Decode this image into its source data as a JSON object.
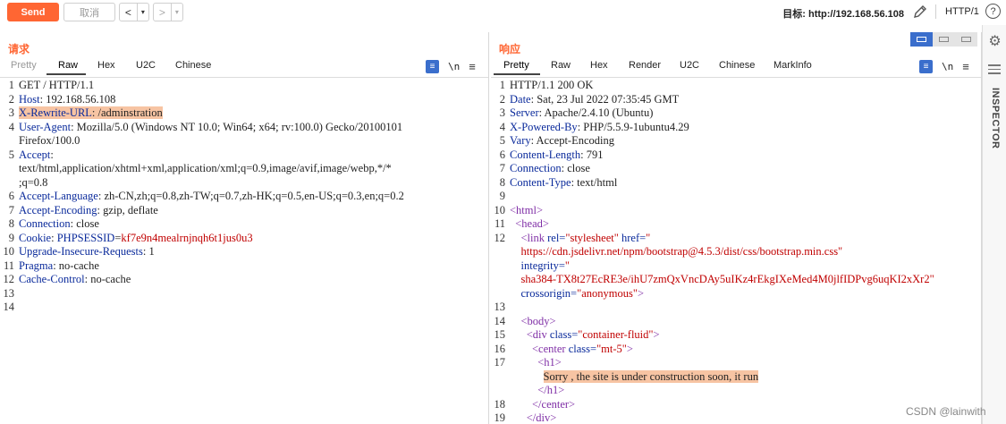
{
  "toolbar": {
    "send_label": "Send",
    "cancel_label": "取消",
    "back_arrow": "<",
    "forward_arrow": ">",
    "dropdown_glyph": "▾",
    "target_label": "目标: http://192.168.56.108",
    "http_version": "HTTP/1",
    "help_glyph": "?"
  },
  "request": {
    "title": "请求",
    "tabs": [
      "Pretty",
      "Raw",
      "Hex",
      "U2C",
      "Chinese"
    ],
    "active_tab": "Raw",
    "lines": [
      {
        "n": "1",
        "parts": [
          {
            "t": "GET / HTTP/1.1",
            "c": "v"
          }
        ]
      },
      {
        "n": "2",
        "parts": [
          {
            "t": "Host",
            "c": "k"
          },
          {
            "t": ": 192.168.56.108",
            "c": "v"
          }
        ]
      },
      {
        "n": "3",
        "parts": [
          {
            "t": "X-Rewrite-URL",
            "c": "k hl"
          },
          {
            "t": ": /adminstration",
            "c": "v hl"
          }
        ]
      },
      {
        "n": "4",
        "parts": [
          {
            "t": "User-Agent",
            "c": "k"
          },
          {
            "t": ": Mozilla/5.0 (Windows NT 10.0; Win64; x64; rv:100.0) Gecko/20100101",
            "c": "v"
          }
        ]
      },
      {
        "n": "",
        "parts": [
          {
            "t": "Firefox/100.0",
            "c": "v"
          }
        ]
      },
      {
        "n": "5",
        "parts": [
          {
            "t": "Accept",
            "c": "k"
          },
          {
            "t": ":",
            "c": "v"
          }
        ]
      },
      {
        "n": "",
        "parts": [
          {
            "t": "text/html,application/xhtml+xml,application/xml;q=0.9,image/avif,image/webp,*/*",
            "c": "v"
          }
        ]
      },
      {
        "n": "",
        "parts": [
          {
            "t": ";q=0.8",
            "c": "v"
          }
        ]
      },
      {
        "n": "6",
        "parts": [
          {
            "t": "Accept-Language",
            "c": "k"
          },
          {
            "t": ": zh-CN,zh;q=0.8,zh-TW;q=0.7,zh-HK;q=0.5,en-US;q=0.3,en;q=0.2",
            "c": "v"
          }
        ]
      },
      {
        "n": "7",
        "parts": [
          {
            "t": "Accept-Encoding",
            "c": "k"
          },
          {
            "t": ": gzip, deflate",
            "c": "v"
          }
        ]
      },
      {
        "n": "8",
        "parts": [
          {
            "t": "Connection",
            "c": "k"
          },
          {
            "t": ": close",
            "c": "v"
          }
        ]
      },
      {
        "n": "9",
        "parts": [
          {
            "t": "Cookie",
            "c": "k"
          },
          {
            "t": ": ",
            "c": "v"
          },
          {
            "t": "PHPSESSID",
            "c": "k"
          },
          {
            "t": "=",
            "c": "v"
          },
          {
            "t": "kf7e9n4mealrnjnqh6t1jus0u3",
            "c": "red"
          }
        ]
      },
      {
        "n": "10",
        "parts": [
          {
            "t": "Upgrade-Insecure-Requests",
            "c": "k"
          },
          {
            "t": ": 1",
            "c": "v"
          }
        ]
      },
      {
        "n": "11",
        "parts": [
          {
            "t": "Pragma",
            "c": "k"
          },
          {
            "t": ": no-cache",
            "c": "v"
          }
        ]
      },
      {
        "n": "12",
        "parts": [
          {
            "t": "Cache-Control",
            "c": "k"
          },
          {
            "t": ": no-cache",
            "c": "v"
          }
        ]
      },
      {
        "n": "13",
        "parts": []
      },
      {
        "n": "14",
        "parts": []
      }
    ]
  },
  "response": {
    "title": "响应",
    "tabs": [
      "Pretty",
      "Raw",
      "Hex",
      "Render",
      "U2C",
      "Chinese",
      "MarkInfo"
    ],
    "active_tab": "Pretty",
    "lines": [
      {
        "n": "1",
        "parts": [
          {
            "t": "HTTP/1.1 200 OK",
            "c": "v"
          }
        ]
      },
      {
        "n": "2",
        "parts": [
          {
            "t": "Date",
            "c": "k"
          },
          {
            "t": ": Sat, 23 Jul 2022 07:35:45 GMT",
            "c": "v"
          }
        ]
      },
      {
        "n": "3",
        "parts": [
          {
            "t": "Server",
            "c": "k"
          },
          {
            "t": ": Apache/2.4.10 (Ubuntu)",
            "c": "v"
          }
        ]
      },
      {
        "n": "4",
        "parts": [
          {
            "t": "X-Powered-By",
            "c": "k"
          },
          {
            "t": ": PHP/5.5.9-1ubuntu4.29",
            "c": "v"
          }
        ]
      },
      {
        "n": "5",
        "parts": [
          {
            "t": "Vary",
            "c": "k"
          },
          {
            "t": ": Accept-Encoding",
            "c": "v"
          }
        ]
      },
      {
        "n": "6",
        "parts": [
          {
            "t": "Content-Length",
            "c": "k"
          },
          {
            "t": ": 791",
            "c": "v"
          }
        ]
      },
      {
        "n": "7",
        "parts": [
          {
            "t": "Connection",
            "c": "k"
          },
          {
            "t": ": close",
            "c": "v"
          }
        ]
      },
      {
        "n": "8",
        "parts": [
          {
            "t": "Content-Type",
            "c": "k"
          },
          {
            "t": ": text/html",
            "c": "v"
          }
        ]
      },
      {
        "n": "9",
        "parts": []
      },
      {
        "n": "10",
        "parts": [
          {
            "t": "<html>",
            "c": "tag"
          }
        ]
      },
      {
        "n": "11",
        "parts": [
          {
            "t": "  <head>",
            "c": "tag"
          }
        ]
      },
      {
        "n": "12",
        "parts": [
          {
            "t": "    <link ",
            "c": "tag"
          },
          {
            "t": "rel=",
            "c": "attr"
          },
          {
            "t": "\"stylesheet\" ",
            "c": "str"
          },
          {
            "t": "href=",
            "c": "attr"
          },
          {
            "t": "\"",
            "c": "str"
          }
        ]
      },
      {
        "n": "",
        "parts": [
          {
            "t": "    https://cdn.jsdelivr.net/npm/bootstrap@4.5.3/dist/css/bootstrap.min.css\"",
            "c": "str"
          }
        ]
      },
      {
        "n": "",
        "parts": [
          {
            "t": "    integrity=",
            "c": "attr"
          },
          {
            "t": "\"",
            "c": "str"
          }
        ]
      },
      {
        "n": "",
        "parts": [
          {
            "t": "    sha384-TX8t27EcRE3e/ihU7zmQxVncDAy5uIKz4rEkgIXeMed4M0jlfIDPvg6uqKI2xXr2\"",
            "c": "str"
          }
        ]
      },
      {
        "n": "",
        "parts": [
          {
            "t": "    crossorigin=",
            "c": "attr"
          },
          {
            "t": "\"anonymous\"",
            "c": "str"
          },
          {
            "t": ">",
            "c": "tag"
          }
        ]
      },
      {
        "n": "13",
        "parts": []
      },
      {
        "n": "14",
        "parts": [
          {
            "t": "    <body>",
            "c": "tag"
          }
        ]
      },
      {
        "n": "15",
        "parts": [
          {
            "t": "      <div ",
            "c": "tag"
          },
          {
            "t": "class=",
            "c": "attr"
          },
          {
            "t": "\"container-fluid\"",
            "c": "str"
          },
          {
            "t": ">",
            "c": "tag"
          }
        ]
      },
      {
        "n": "16",
        "parts": [
          {
            "t": "        <center ",
            "c": "tag"
          },
          {
            "t": "class=",
            "c": "attr"
          },
          {
            "t": "\"mt-5\"",
            "c": "str"
          },
          {
            "t": ">",
            "c": "tag"
          }
        ]
      },
      {
        "n": "17",
        "parts": [
          {
            "t": "          <h1>",
            "c": "tag"
          }
        ]
      },
      {
        "n": "",
        "parts": [
          {
            "t": "            ",
            "c": "v"
          },
          {
            "t": "Sorry , the site is under construction soon, it run",
            "c": "v hl"
          }
        ]
      },
      {
        "n": "",
        "parts": [
          {
            "t": "          </h1>",
            "c": "tag"
          }
        ]
      },
      {
        "n": "18",
        "parts": [
          {
            "t": "        </center>",
            "c": "tag"
          }
        ]
      },
      {
        "n": "19",
        "parts": [
          {
            "t": "      </div>",
            "c": "tag"
          }
        ]
      }
    ]
  },
  "sidebar": {
    "inspector_label": "INSPECTOR"
  },
  "watermark": "CSDN @lainwith",
  "colors": {
    "accent": "#ff6633",
    "header_key": "#0a2a9b",
    "string": "#c00000",
    "tag": "#7f2ea6",
    "highlight": "#f7c4a3",
    "toggle_active": "#3a6ecc"
  }
}
